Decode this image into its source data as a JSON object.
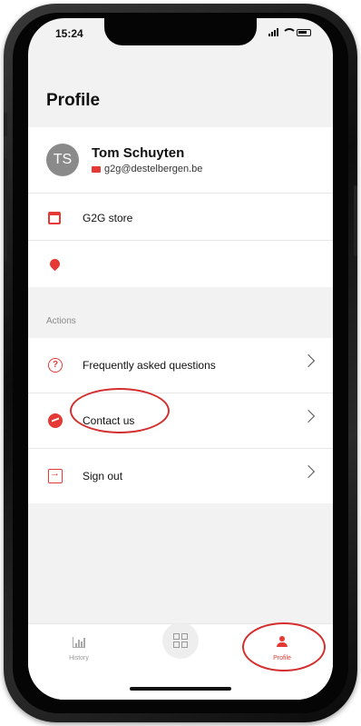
{
  "status": {
    "time": "15:24"
  },
  "page": {
    "title": "Profile"
  },
  "profile": {
    "initials": "TS",
    "name": "Tom Schuyten",
    "email": "g2g@destelbergen.be",
    "store": "G2G store",
    "location": ""
  },
  "actions": {
    "section_label": "Actions",
    "items": [
      {
        "label": "Frequently asked questions",
        "icon": "help-circle-icon"
      },
      {
        "label": "Contact us",
        "icon": "messenger-icon"
      },
      {
        "label": "Sign out",
        "icon": "sign-out-icon"
      }
    ]
  },
  "tabbar": {
    "history": "History",
    "profile": "Profile",
    "active": "Profile"
  },
  "colors": {
    "accent": "#e53935",
    "annotation": "#d32f2f",
    "background": "#f2f2f2"
  }
}
